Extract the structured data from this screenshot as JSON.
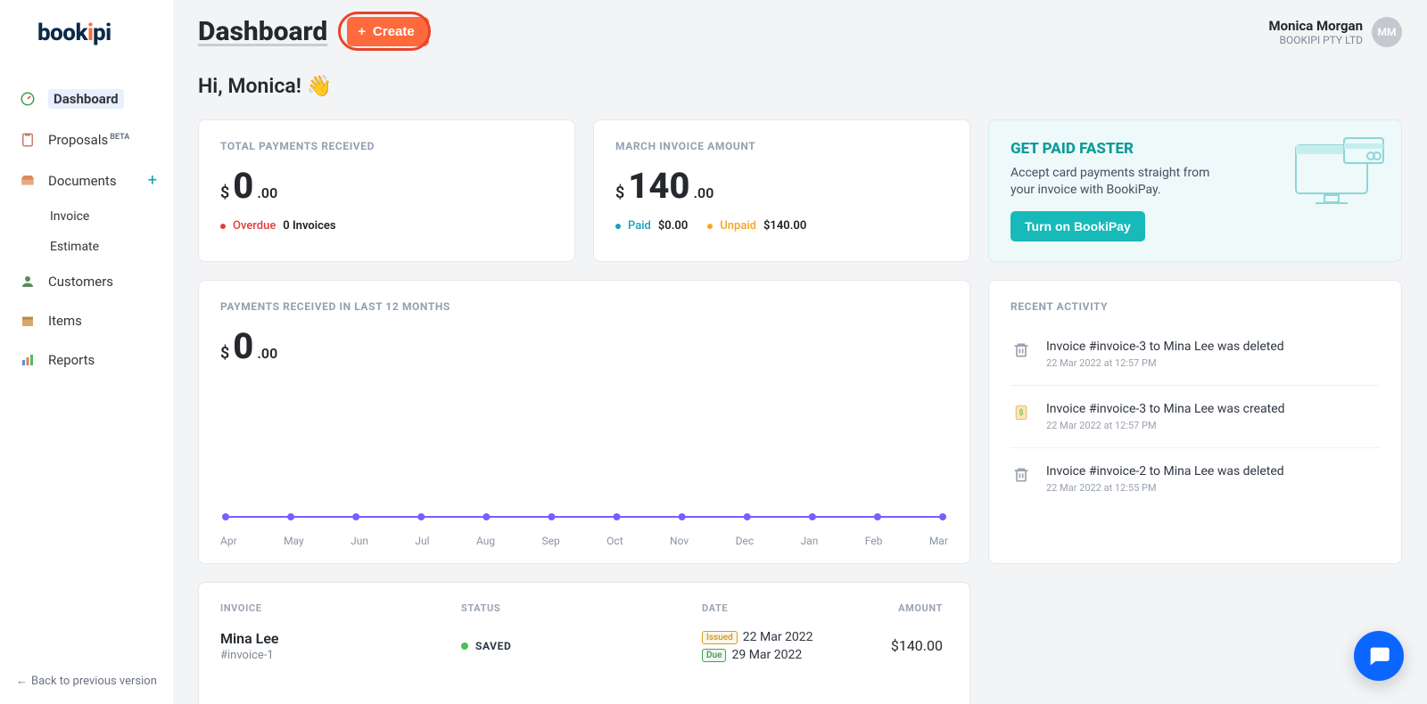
{
  "brand": {
    "text": "bookipi"
  },
  "sidebar": {
    "items": [
      {
        "label": "Dashboard"
      },
      {
        "label": "Proposals",
        "badge": "BETA"
      },
      {
        "label": "Documents"
      },
      {
        "label": "Customers"
      },
      {
        "label": "Items"
      },
      {
        "label": "Reports"
      }
    ],
    "subitems": [
      {
        "label": "Invoice"
      },
      {
        "label": "Estimate"
      }
    ],
    "footer": "Back to previous version"
  },
  "header": {
    "title": "Dashboard",
    "create_label": "Create",
    "user_name": "Monica Morgan",
    "company": "BOOKIPI PTY LTD",
    "avatar_initials": "MM"
  },
  "greeting": "Hi, Monica! 👋",
  "cards": {
    "total_payments": {
      "title": "TOTAL PAYMENTS RECEIVED",
      "currency": "$",
      "int": "0",
      "dec": ".00",
      "overdue_label": "Overdue",
      "overdue_value": "0 Invoices"
    },
    "month_invoice": {
      "title": "MARCH INVOICE AMOUNT",
      "currency": "$",
      "int": "140",
      "dec": ".00",
      "paid_label": "Paid",
      "paid_value": "$0.00",
      "unpaid_label": "Unpaid",
      "unpaid_value": "$140.00"
    },
    "promo": {
      "title": "GET PAID FASTER",
      "text": "Accept card payments straight from your invoice with BookiPay.",
      "button": "Turn on BookiPay"
    }
  },
  "chart": {
    "title": "PAYMENTS RECEIVED IN LAST 12 MONTHS",
    "currency": "$",
    "int": "0",
    "dec": ".00"
  },
  "chart_data": {
    "type": "line",
    "title": "PAYMENTS RECEIVED IN LAST 12 MONTHS",
    "categories": [
      "Apr",
      "May",
      "Jun",
      "Jul",
      "Aug",
      "Sep",
      "Oct",
      "Nov",
      "Dec",
      "Jan",
      "Feb",
      "Mar"
    ],
    "values": [
      0,
      0,
      0,
      0,
      0,
      0,
      0,
      0,
      0,
      0,
      0,
      0
    ],
    "xlabel": "",
    "ylabel": "$",
    "ylim": [
      0,
      1
    ]
  },
  "activity": {
    "title": "RECENT ACTIVITY",
    "items": [
      {
        "icon": "trash",
        "text": "Invoice #invoice-3 to Mina Lee was deleted",
        "time": "22 Mar 2022 at 12:57 PM"
      },
      {
        "icon": "invoice",
        "text": "Invoice #invoice-3 to Mina Lee was created",
        "time": "22 Mar 2022 at 12:57 PM"
      },
      {
        "icon": "trash",
        "text": "Invoice #invoice-2 to Mina Lee was deleted",
        "time": "22 Mar 2022 at 12:55 PM"
      }
    ]
  },
  "table": {
    "columns": {
      "invoice": "INVOICE",
      "status": "STATUS",
      "date": "DATE",
      "amount": "AMOUNT"
    },
    "row": {
      "customer": "Mina Lee",
      "invoice_id": "#invoice-1",
      "status": "SAVED",
      "issued_label": "Issued",
      "issued_date": "22 Mar 2022",
      "due_label": "Due",
      "due_date": "29 Mar 2022",
      "amount": "$140.00"
    }
  }
}
